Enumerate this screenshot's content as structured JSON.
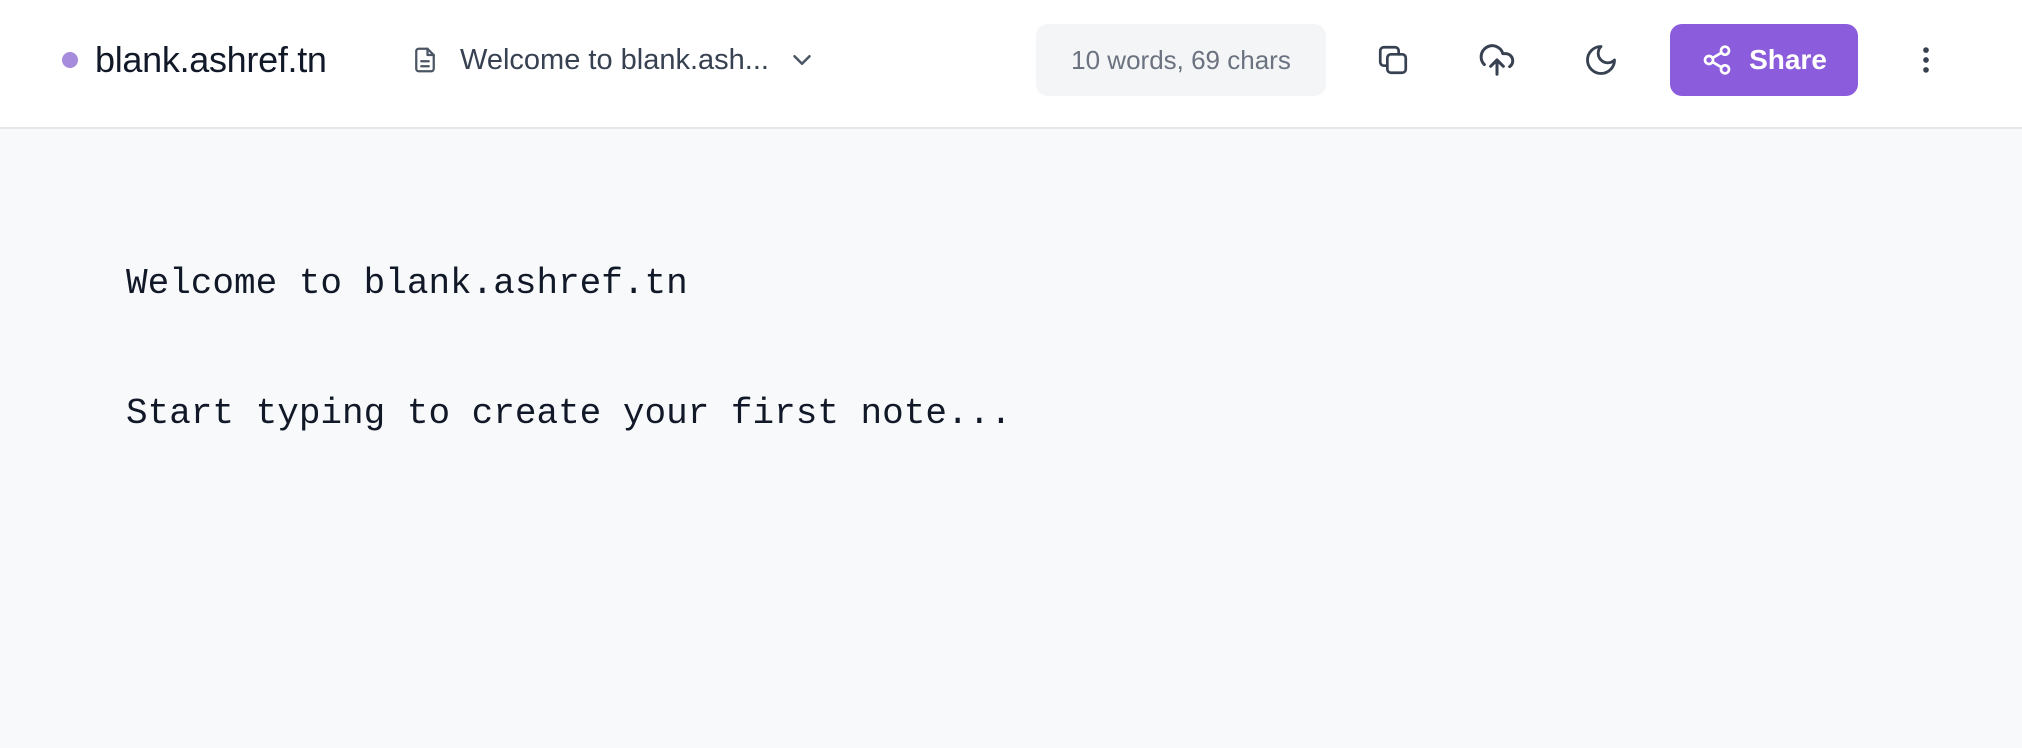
{
  "app": {
    "brand": "blank.ashref.tn",
    "accent_color": "#8b5cdb",
    "dot_color": "#a78bdc"
  },
  "document": {
    "selected_title": "Welcome to blank.ash...",
    "icon": "document-icon"
  },
  "stats": {
    "text": "10 words, 69 chars"
  },
  "toolbar": {
    "copy_icon": "copy-icon",
    "upload_icon": "cloud-upload-icon",
    "theme_icon": "moon-icon",
    "share_label": "Share",
    "more_icon": "more-vertical-icon"
  },
  "editor": {
    "lines": [
      "Welcome to blank.ashref.tn",
      "",
      "Start typing to create your first note..."
    ]
  }
}
